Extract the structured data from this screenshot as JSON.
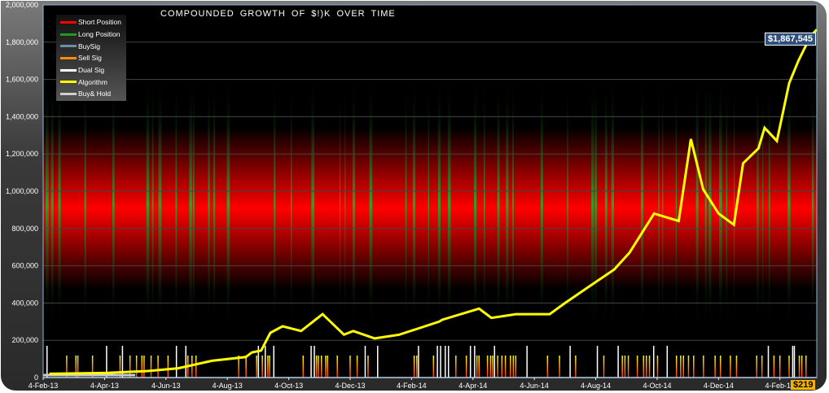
{
  "chart_data": {
    "type": "line",
    "title": "COMPOUNDED  GROWTH  OF $!)K OVER TIME",
    "ylim": [
      0,
      2000000
    ],
    "yticks": [
      "0",
      "200,000",
      "400,000",
      "600,000",
      "800,000",
      "1,000,000",
      "1,200,000",
      "1,400,000",
      "1,600,000",
      "1,800,000",
      "2,000,000"
    ],
    "xlim_months": [
      0,
      25.2
    ],
    "xticks": [
      "4-Feb-13",
      "4-Apr-13",
      "4-Jun-13",
      "4-Aug-13",
      "4-Oct-13",
      "4-Dec-13",
      "4-Feb-14",
      "4-Apr-14",
      "4-Jun-14",
      "4-Aug-14",
      "4-Oct-14",
      "4-Dec-14",
      "4-Feb-15"
    ],
    "legend": [
      {
        "label": "Short Position",
        "color": "#ff0000"
      },
      {
        "label": "Long Position",
        "color": "#1f9a1f"
      },
      {
        "label": "BuySig",
        "color": "#6e8fa0"
      },
      {
        "label": "Sell Sig",
        "color": "#ff8c00"
      },
      {
        "label": "Dual Sig",
        "color": "#ffffff"
      },
      {
        "label": "Algorithm",
        "color": "#ffff00"
      },
      {
        "label": "Buy& Hold",
        "color": "#d0d0d0"
      }
    ],
    "legend_placement": "top-left",
    "series": [
      {
        "name": "Algorithm",
        "color": "#ffff00",
        "x": [
          0.2,
          2.1,
          3.4,
          4.4,
          5.5,
          6.6,
          6.8,
          7.1,
          7.4,
          7.8,
          8.4,
          9.1,
          9.8,
          10.1,
          10.8,
          11.6,
          12.9,
          13.0,
          14.2,
          14.6,
          15.4,
          16.5,
          17.0,
          17.8,
          18.6,
          19.1,
          19.9,
          20.3,
          20.7,
          21.1,
          21.5,
          22.0,
          22.5,
          22.8,
          23.3,
          23.5,
          23.9,
          24.3,
          24.6,
          24.9,
          25.05,
          25.2
        ],
        "y": [
          20000,
          25000,
          35000,
          50000,
          90000,
          110000,
          135000,
          145000,
          240000,
          275000,
          250000,
          340000,
          230000,
          250000,
          210000,
          230000,
          300000,
          310000,
          370000,
          320000,
          340000,
          340000,
          400000,
          490000,
          580000,
          670000,
          880000,
          860000,
          840000,
          1280000,
          1010000,
          880000,
          820000,
          1150000,
          1230000,
          1340000,
          1270000,
          1580000,
          1700000,
          1800000,
          1840000,
          1867545
        ]
      }
    ],
    "end_label": "$1,867,545",
    "last_badge": "$219"
  }
}
